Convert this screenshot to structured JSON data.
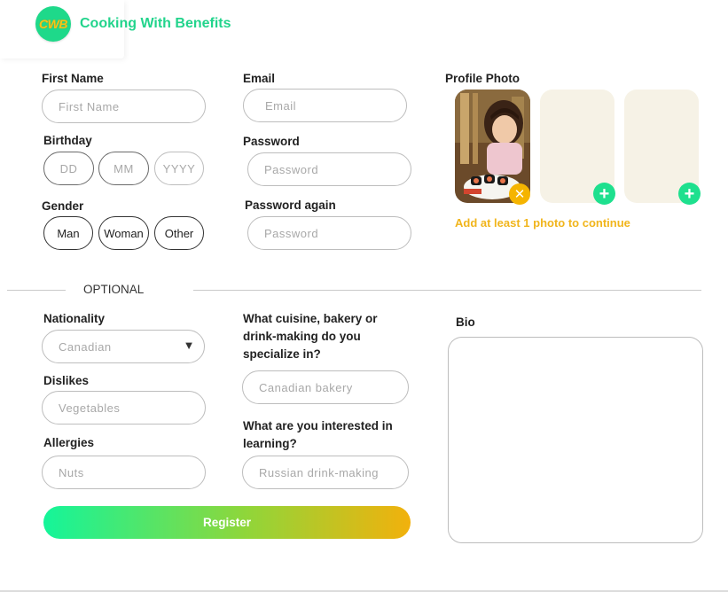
{
  "header": {
    "logo_text": "CWB",
    "brand_name": "Cooking With Benefits"
  },
  "form": {
    "first_name": {
      "label": "First Name",
      "placeholder": "First Name"
    },
    "birthday": {
      "label": "Birthday",
      "dd": "DD",
      "mm": "MM",
      "yyyy": "YYYY"
    },
    "gender": {
      "label": "Gender",
      "options": [
        "Man",
        "Woman",
        "Other"
      ]
    },
    "email": {
      "label": "Email",
      "placeholder": "Email"
    },
    "password": {
      "label": "Password",
      "placeholder": "Password"
    },
    "password_again": {
      "label": "Password again",
      "placeholder": "Password"
    }
  },
  "profile_photo": {
    "label": "Profile Photo",
    "hint": "Add at least 1 photo to continue"
  },
  "optional_section": {
    "title": "OPTIONAL",
    "nationality": {
      "label": "Nationality",
      "selected": "Canadian"
    },
    "dislikes": {
      "label": "Dislikes",
      "placeholder": "Vegetables"
    },
    "allergies": {
      "label": "Allergies",
      "placeholder": "Nuts"
    },
    "specialty": {
      "label": "What cuisine, bakery or drink-making do you specialize in?",
      "placeholder": "Canadian bakery"
    },
    "learning": {
      "label": "What are you interested in learning?",
      "placeholder": "Russian drink-making"
    },
    "bio": {
      "label": "Bio"
    }
  },
  "actions": {
    "register_label": "Register"
  },
  "colors": {
    "brand_green": "#22d48c",
    "accent_yellow": "#f1b51c",
    "plus_green": "#1ee08e"
  }
}
